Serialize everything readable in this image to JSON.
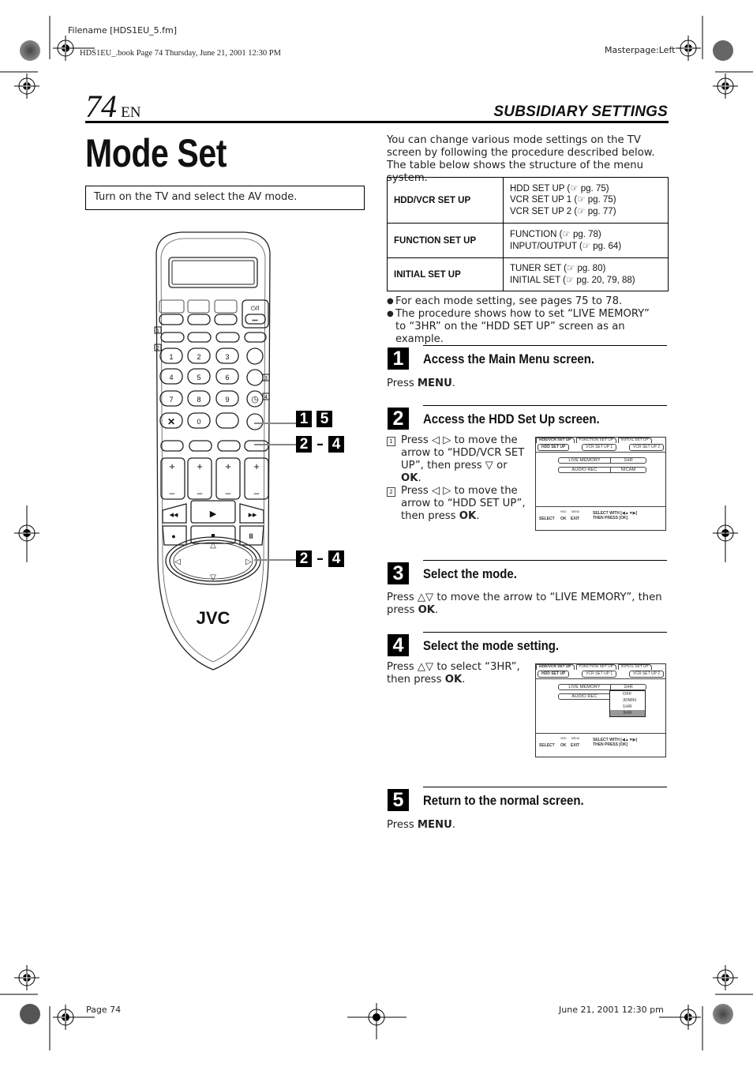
{
  "slug": {
    "filename": "Filename [HDS1EU_5.fm]",
    "book_line": "HDS1EU_.book  Page 74  Thursday, June 21, 2001  12:30 PM",
    "masterpage": "Masterpage:Left",
    "footer_left": "Page 74",
    "footer_right": "June 21, 2001 12:30 pm"
  },
  "header": {
    "page_number": "74",
    "language": "EN",
    "section": "SUBSIDIARY SETTINGS"
  },
  "title": "Mode Set",
  "prerequisite": "Turn on the TV and select the AV mode.",
  "intro": {
    "line1": "You can change various mode settings on the TV screen by following the procedure described below.",
    "line2": "The table below shows the structure of the menu system."
  },
  "menu_table": [
    {
      "category": "HDD/VCR SET UP",
      "items": [
        "HDD SET UP (☞ pg. 75)",
        "VCR SET UP 1 (☞ pg. 75)",
        "VCR SET UP 2 (☞ pg. 77)"
      ]
    },
    {
      "category": "FUNCTION SET UP",
      "items": [
        "FUNCTION (☞ pg. 78)",
        "INPUT/OUTPUT (☞ pg. 64)"
      ]
    },
    {
      "category": "INITIAL SET UP",
      "items": [
        "TUNER SET (☞ pg. 80)",
        "INITIAL SET (☞ pg. 20, 79, 88)"
      ]
    }
  ],
  "notes": [
    "For each mode setting, see pages 75 to 78.",
    "The procedure shows how to set “LIVE MEMORY” to “3HR” on the “HDD SET UP” screen as an example."
  ],
  "steps": [
    {
      "number": "1",
      "title": "Access the Main Menu screen.",
      "text_pre": "Press ",
      "text_bold": "MENU",
      "text_post": "."
    },
    {
      "number": "2",
      "title": "Access the HDD Set Up screen.",
      "sub": [
        {
          "num": "1",
          "pre": "Press ◁ ▷ to move the arrow to “HDD/VCR SET UP”, then press ▽ or ",
          "bold": "OK",
          "post": "."
        },
        {
          "num": "2",
          "pre": "Press ◁ ▷ to move the arrow to “HDD SET UP”, then press ",
          "bold": "OK",
          "post": "."
        }
      ]
    },
    {
      "number": "3",
      "title": "Select the mode.",
      "text_pre": "Press △▽ to move the arrow to “LIVE MEMORY”, then press ",
      "text_bold": "OK",
      "text_post": "."
    },
    {
      "number": "4",
      "title": "Select the mode setting.",
      "text_pre": "Press △▽ to select “3HR”, then press ",
      "text_bold": "OK",
      "text_post": "."
    },
    {
      "number": "5",
      "title": "Return to the normal screen.",
      "text_pre": "Press ",
      "text_bold": "MENU",
      "text_post": "."
    }
  ],
  "osd": {
    "tabs": [
      "HDD/VCR SET UP",
      "FUNCTION SET UP",
      "INITIAL SET UP"
    ],
    "subtabs": [
      "HDD SET UP",
      "VCR SET UP 1",
      "VCR SET UP 2"
    ],
    "rows": [
      {
        "label": "LIVE MEMORY",
        "value": "1HR"
      },
      {
        "label": "AUDIO REC",
        "value": "NICAM"
      }
    ],
    "dropdown_options": [
      "OFF",
      "30MIN",
      "1HR",
      "3HR"
    ],
    "dropdown_selected": "3HR",
    "footer": {
      "select": "SELECT",
      "ok_top": "HDD",
      "ok": "OK",
      "exit_top": "MENU",
      "exit": "EXIT",
      "hint1": "SELECT WITH [◀▲▼▶]",
      "hint2": "THEN PRESS [OK]"
    }
  },
  "remote": {
    "brand": "JVC",
    "keypad": [
      "1",
      "2",
      "3",
      "4",
      "5",
      "6",
      "7",
      "8",
      "9",
      "0"
    ],
    "callouts": [
      {
        "from": "1",
        "to": "5",
        "sep": ""
      },
      {
        "from": "2",
        "to": "4",
        "sep": "–"
      },
      {
        "from": "2",
        "to": "4",
        "sep": "–"
      }
    ],
    "markers": [
      "1",
      "2",
      "3",
      "4"
    ]
  }
}
